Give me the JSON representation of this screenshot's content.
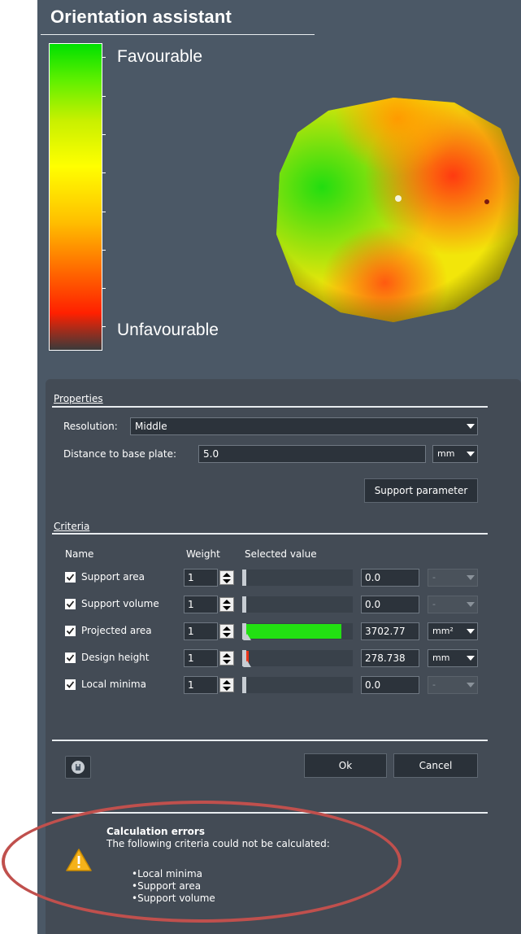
{
  "header": {
    "title": "Orientation assistant"
  },
  "legend": {
    "top_label": "Favourable",
    "bottom_label": "Unfavourable"
  },
  "properties": {
    "section_label": "Properties",
    "resolution_label": "Resolution:",
    "resolution_value": "Middle",
    "distance_label": "Distance to base plate:",
    "distance_value": "5.0",
    "distance_unit": "mm",
    "support_button": "Support parameter"
  },
  "criteria": {
    "section_label": "Criteria",
    "col_name": "Name",
    "col_weight": "Weight",
    "col_selected": "Selected value",
    "rows": [
      {
        "name": "Support area",
        "weight": "1",
        "bar_fraction": 0,
        "bar_color": "",
        "value": "0.0",
        "unit": "-",
        "unit_enabled": false
      },
      {
        "name": "Support volume",
        "weight": "1",
        "bar_fraction": 0,
        "bar_color": "",
        "value": "0.0",
        "unit": "-",
        "unit_enabled": false
      },
      {
        "name": "Projected area",
        "weight": "1",
        "bar_fraction": 0.9,
        "bar_color": "#22e012",
        "value": "3702.77",
        "unit": "mm²",
        "unit_enabled": true
      },
      {
        "name": "Design height",
        "weight": "1",
        "bar_fraction": 0.06,
        "bar_color": "#e8351a",
        "value": "278.738",
        "unit": "mm",
        "unit_enabled": true
      },
      {
        "name": "Local minima",
        "weight": "1",
        "bar_fraction": 0,
        "bar_color": "",
        "value": "0.0",
        "unit": "-",
        "unit_enabled": false
      }
    ]
  },
  "actions": {
    "ok_label": "Ok",
    "cancel_label": "Cancel"
  },
  "errors": {
    "title": "Calculation errors",
    "description": "The following criteria could not be calculated:",
    "items": [
      "Local minima",
      "Support area",
      "Support volume"
    ]
  },
  "colors": {
    "background": "#4b5866",
    "panel": "#434b55",
    "annotation": "#c0504d",
    "favourable": "#00e000",
    "unfavourable": "#ff2000"
  }
}
